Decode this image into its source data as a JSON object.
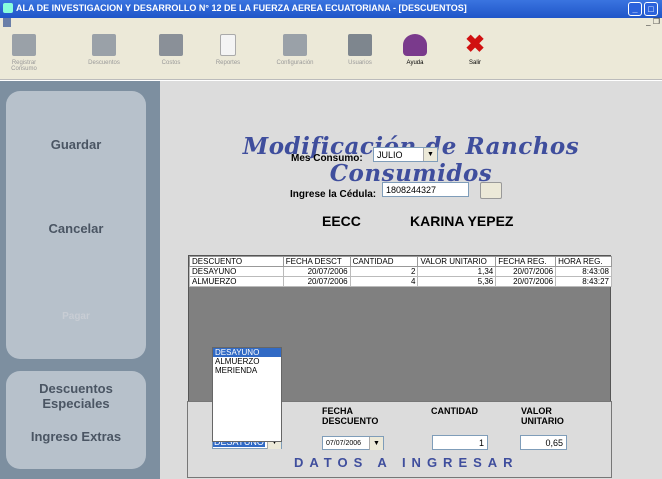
{
  "window": {
    "title": "ALA DE INVESTIGACION Y DESARROLLO N° 12 DE LA FUERZA AEREA ECUATORIANA - [DESCUENTOS]",
    "minimize": "_",
    "maximize": "□",
    "restore": "_ ❐"
  },
  "toolbar": {
    "items": [
      {
        "label": "Registrar Consumo",
        "icon": "register-consumption-icon"
      },
      {
        "label": "Descuentos",
        "icon": "discounts-icon"
      },
      {
        "label": "Costos",
        "icon": "costs-icon"
      },
      {
        "label": "Reportes",
        "icon": "reports-icon"
      },
      {
        "label": "Configuración",
        "icon": "settings-icon"
      },
      {
        "label": "Usuarios",
        "icon": "users-icon"
      },
      {
        "label": "Ayuda",
        "icon": "help-book-icon"
      },
      {
        "label": "Salir",
        "icon": "exit-x-icon"
      }
    ]
  },
  "sidebar": {
    "guardar": "Guardar",
    "cancelar": "Cancelar",
    "disabled_btn": "Pagar",
    "descuentos_especiales": "Descuentos Especiales",
    "ingreso_extras": "Ingreso Extras"
  },
  "main": {
    "heading": "Modificación de Ranchos Consumidos",
    "mes_label": "Mes Consumo:",
    "mes_value": "JULIO",
    "cedula_label": "Ingrese la Cédula:",
    "cedula_value": "1808244327",
    "unit": "EECC",
    "person": "KARINA YEPEZ"
  },
  "grid": {
    "headers": [
      "DESCUENTO",
      "FECHA DESCT",
      "CANTIDAD",
      "VALOR UNITARIO",
      "FECHA REG.",
      "HORA REG."
    ],
    "rows": [
      [
        "DESAYUNO",
        "20/07/2006",
        "2",
        "1,34",
        "20/07/2006",
        "8:43:08"
      ],
      [
        "ALMUERZO",
        "20/07/2006",
        "4",
        "5,36",
        "20/07/2006",
        "8:43:27"
      ]
    ]
  },
  "entry": {
    "list_options": [
      "DESAYUNO",
      "ALMUERZO",
      "MERIENDA"
    ],
    "descuento_value": "DESAYUNO",
    "fecha_label": "FECHA DESCUENTO",
    "fecha_value": "07/07/2006",
    "cantidad_label": "CANTIDAD",
    "cantidad_value": "1",
    "valor_label": "VALOR UNITARIO",
    "valor_value": "0,65",
    "footer": "DATOS A INGRESAR"
  }
}
